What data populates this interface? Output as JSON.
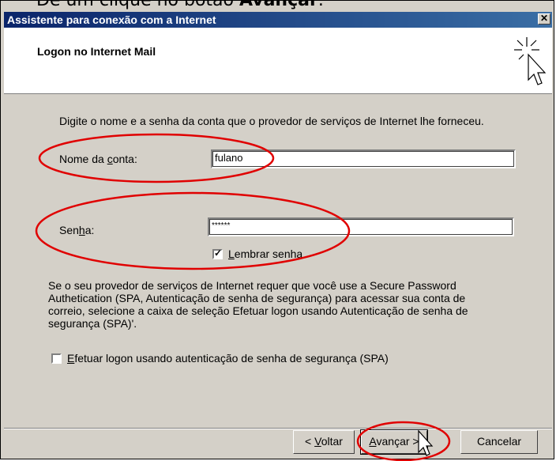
{
  "caption": {
    "prefix": "Dê um clique no botão ",
    "bold": "Avançar",
    "suffix": "."
  },
  "window": {
    "title": "Assistente para conexão com a Internet",
    "close_glyph": "✕"
  },
  "header": {
    "title": "Logon no Internet Mail"
  },
  "intro": "Digite o nome e a senha da conta que o provedor de serviços de Internet lhe forneceu.",
  "account": {
    "label_pre": "Nome da ",
    "label_accel": "c",
    "label_post": "onta:",
    "value": "fulano"
  },
  "password": {
    "label_pre": "Sen",
    "label_accel": "h",
    "label_post": "a:",
    "value": "******"
  },
  "remember": {
    "accel": "L",
    "rest": "embrar senha",
    "checked": true
  },
  "spa_info": [
    "Se o seu provedor de serviços de Internet requer que você use a Secure Password",
    "Authetication (SPA, Autenticação de senha de segurança) para acessar sua conta de",
    "correio, selecione a caixa de seleção Efetuar logon usando Autenticação de senha de",
    "segurança (SPA)'."
  ],
  "spa_checkbox": {
    "accel": "E",
    "rest": "fetuar logon usando autenticação de senha de segurança (SPA)",
    "checked": false
  },
  "buttons": {
    "back": {
      "pre": "< ",
      "accel": "V",
      "rest": "oltar"
    },
    "next": {
      "accel": "A",
      "rest": "vançar >"
    },
    "cancel": "Cancelar"
  },
  "colors": {
    "highlight_ellipse": "#e00000",
    "titlebar_start": "#0a246a",
    "titlebar_end": "#3a6ea5",
    "dialog_bg": "#d4d0c8"
  }
}
